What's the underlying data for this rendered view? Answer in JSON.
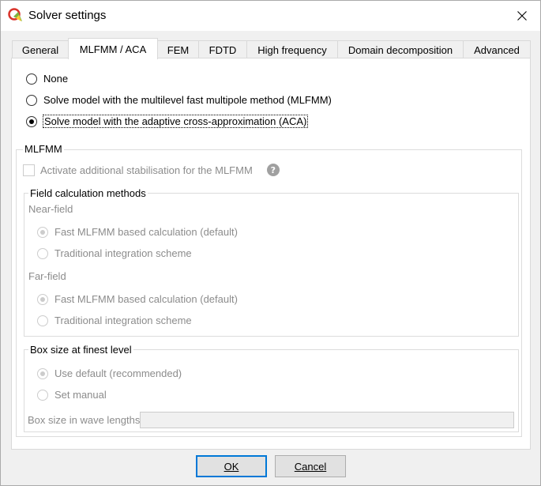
{
  "window": {
    "title": "Solver settings",
    "app_icon": "cadfeko-logo-icon",
    "close_icon": "close-icon"
  },
  "tabs": [
    {
      "label": "General",
      "active": false
    },
    {
      "label": "MLFMM / ACA",
      "active": true
    },
    {
      "label": "FEM",
      "active": false
    },
    {
      "label": "FDTD",
      "active": false
    },
    {
      "label": "High frequency",
      "active": false
    },
    {
      "label": "Domain decomposition",
      "active": false
    },
    {
      "label": "Advanced",
      "active": false
    }
  ],
  "solver_method": {
    "options": [
      {
        "label": "None",
        "checked": false
      },
      {
        "label": "Solve model with the multilevel fast multipole method (MLFMM)",
        "checked": false
      },
      {
        "label": "Solve model with the adaptive cross-approximation (ACA)",
        "checked": true
      }
    ]
  },
  "mlfmm": {
    "title": "MLFMM",
    "stabilisation_label": "Activate additional stabilisation for the MLFMM",
    "stabilisation_checked": false,
    "help_glyph": "?",
    "field_calc": {
      "title": "Field calculation methods",
      "near_field": {
        "label": "Near-field",
        "options": [
          {
            "label": "Fast MLFMM based calculation (default)",
            "checked": true
          },
          {
            "label": "Traditional integration scheme",
            "checked": false
          }
        ]
      },
      "far_field": {
        "label": "Far-field",
        "options": [
          {
            "label": "Fast MLFMM based calculation (default)",
            "checked": true
          },
          {
            "label": "Traditional integration scheme",
            "checked": false
          }
        ]
      }
    },
    "box_size": {
      "title": "Box size at finest level",
      "options": [
        {
          "label": "Use default (recommended)",
          "checked": true
        },
        {
          "label": "Set manual",
          "checked": false
        }
      ],
      "wave_lengths_label": "Box size in wave lengths",
      "wave_lengths_value": ""
    }
  },
  "buttons": {
    "ok": "OK",
    "cancel": "Cancel"
  },
  "colors": {
    "focus_border": "#0078d7",
    "disabled_text": "#8c8c8c"
  }
}
